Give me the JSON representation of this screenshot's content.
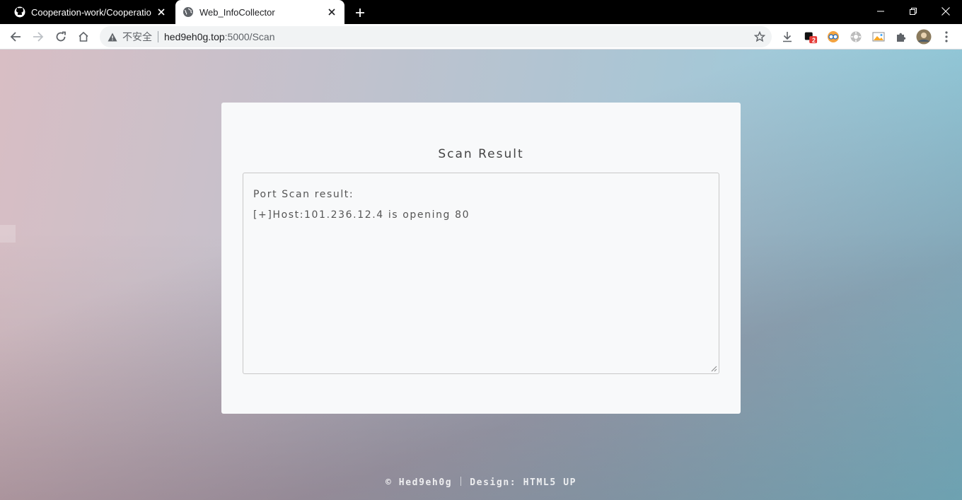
{
  "browser": {
    "tabs": [
      {
        "title": "Cooperation-work/Cooperatio",
        "icon": "github-icon",
        "active": false
      },
      {
        "title": "Web_InfoCollector",
        "icon": "globe-icon",
        "active": true
      }
    ],
    "address_bar": {
      "security_label": "不安全",
      "host": "hed9eh0g.top",
      "path": ":5000/Scan"
    },
    "extension_badge": "2"
  },
  "page": {
    "card_title": "Scan Result",
    "result_lines": [
      "Port Scan result:",
      "[+]Host:101.236.12.4 is opening 80"
    ],
    "footer": {
      "copyright": "© Hed9eh0g",
      "design": "Design: HTML5 UP"
    }
  }
}
